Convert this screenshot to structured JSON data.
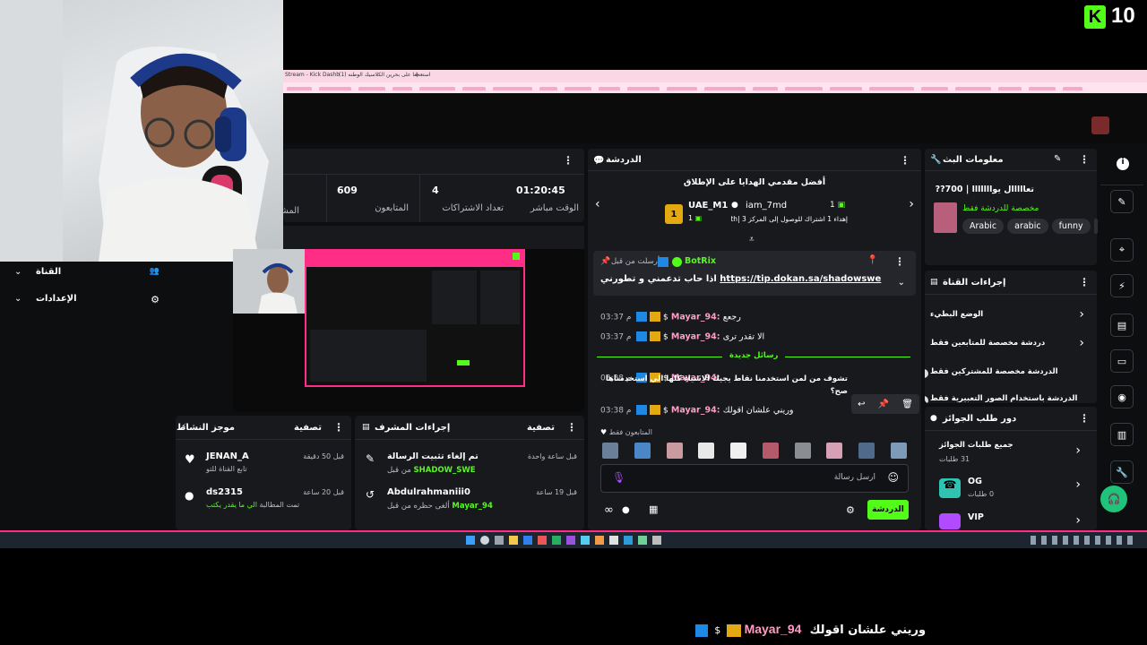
{
  "brand": {
    "logo": "K",
    "count": "10"
  },
  "browser": {
    "tabs": [
      "Stream - Kick Dashb",
      "(1) استعدلنا على بحرين الكلاسيك الوطنه",
      "+"
    ]
  },
  "stats": {
    "items": [
      {
        "value": "01:20:45",
        "label": "الوقت مباشر"
      },
      {
        "value": "4",
        "label": "تعداد الاشتراكات"
      },
      {
        "value": "609",
        "label": "المتابعون"
      },
      {
        "value": "",
        "label": "المشا"
      }
    ]
  },
  "left_menu": {
    "channel": "القناة",
    "settings": "الإعدادات"
  },
  "activity": {
    "title": "موجز النشاط",
    "filter": "تصفية",
    "items": [
      {
        "user": "JENAN_A",
        "time": "قبل 50 دقيقة",
        "detail": "تابع القناة للتو"
      },
      {
        "user": "ds2315",
        "time": "قبل 20 ساعة",
        "detail_prefix": "تمت المطالبة ",
        "detail_green": "الي ما يقدر يكتب"
      }
    ]
  },
  "mod_actions": {
    "title": "إجراءات المشرف",
    "filter": "تصفية",
    "items": [
      {
        "user": "تم إلغاء تثبيت الرسالة",
        "time": "قبل ساعة واحدة",
        "detail_prefix": "من قبل ",
        "detail_green": "SHADOW_SWE"
      },
      {
        "user": "Abdulrahmaniii0",
        "time": "قبل 19 ساعة",
        "detail_prefix": "ألغى حظره من قبل ",
        "detail_green": "Mayar_94"
      }
    ]
  },
  "chat": {
    "title": "الدردشة",
    "gifters_title": "أفضل مقدمي الهدايا على الإطلاق",
    "gifter1": {
      "name": "UAE_M1",
      "badge": "1",
      "count": "1"
    },
    "gifter2": {
      "name": "iam_7md",
      "count": "1",
      "note": "إهداء 1 اشتراك للوصول إلى المركز 3 |th"
    },
    "pinned": {
      "label": "أرسلت من قبل",
      "user": "BotRix",
      "message": "اذا حاب تدعمني و تطورني",
      "link": "https://tip.dokan.sa/shadowswe"
    },
    "messages": [
      {
        "time": "03:37 م",
        "user": "Mayar_94:",
        "text": "رجعع"
      },
      {
        "time": "03:37 م",
        "user": "Mayar_94:",
        "text": "الا تقدر ترى"
      },
      {
        "time": "03:38 م",
        "user": "Mayar_94:",
        "text": "تشوف من لمن استخدمنا نقاط يجيك الاشياء كلها الي استخدمناها صح؟"
      },
      {
        "time": "03:38 م",
        "user": "Mayar_94:",
        "text": "وريني علشان اقولك"
      }
    ],
    "new_messages": "رسائل جديدة",
    "followers_only": "المتابعون فقط",
    "input_placeholder": "ارسل رسالة",
    "send_button": "الدردشة",
    "colors": {
      "accent": "#53fc18",
      "pink": "#ff2d86"
    }
  },
  "stream_info": {
    "title": "معلومات البث",
    "stream_title": "تعااااال يوااااااا | 700??",
    "subtitle": "مخصصة للدردشة فقط",
    "tags": [
      "Arabic",
      "arabic",
      "funny"
    ]
  },
  "channel_actions": {
    "title": "إجراءات القناة",
    "items": [
      {
        "label": "الوضع البطيء"
      },
      {
        "label": "دردشة مخصصة للمتابعين فقط"
      },
      {
        "label": "الدردشة مخصصة للمشتركين فقط"
      },
      {
        "label": "الدردشة باستخدام الصور التعبيرية فقط"
      }
    ]
  },
  "rewards": {
    "title": "دور طلب الجوائز",
    "all_label": "جميع طلبات الجوائز",
    "all_count": "31 طلبات",
    "og_label": "OG",
    "og_count": "0 طلبات",
    "vip_label": "VIP"
  },
  "overlay": {
    "user": "Mayar_94",
    "text": "وريني علشان اقولك"
  }
}
